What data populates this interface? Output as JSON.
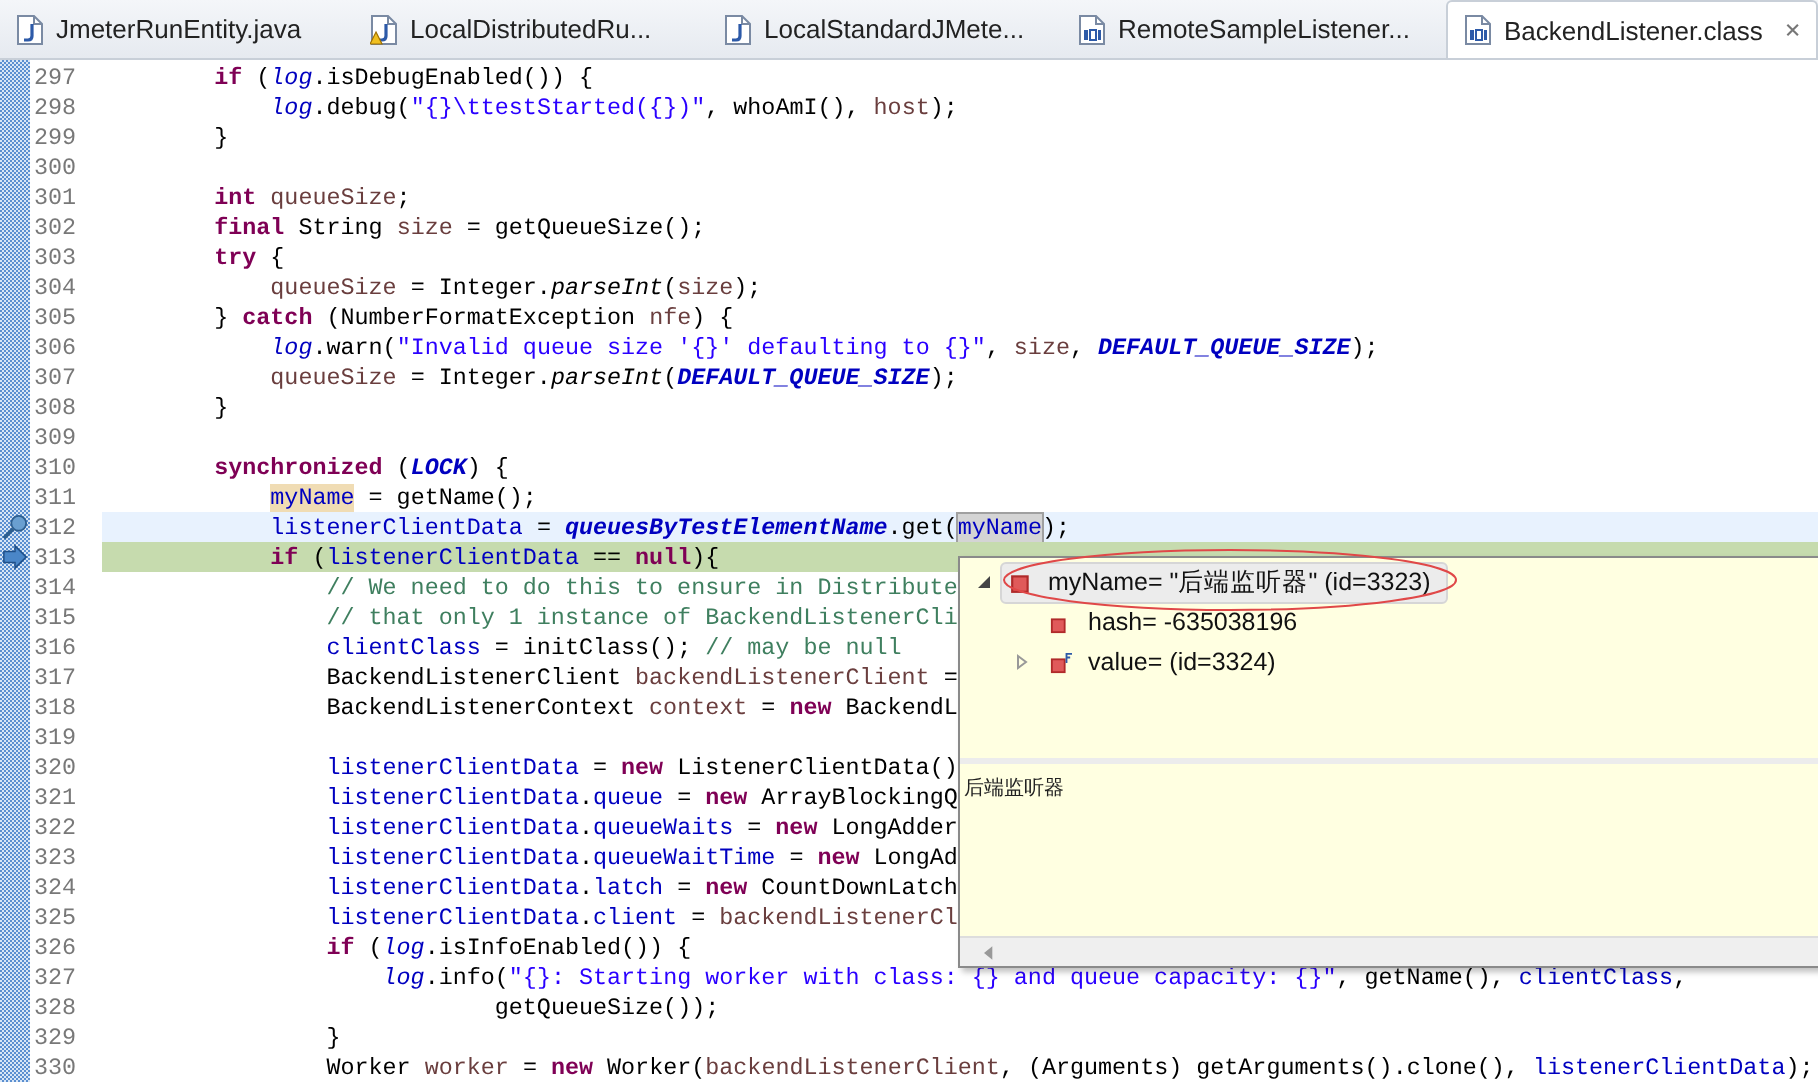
{
  "tabs": [
    {
      "label": "JmeterRunEntity.java",
      "kind": "java",
      "selected": false
    },
    {
      "label": "LocalDistributedRu...",
      "kind": "warning",
      "selected": false
    },
    {
      "label": "LocalStandardJMete...",
      "kind": "java",
      "selected": false
    },
    {
      "label": "RemoteSampleListener...",
      "kind": "class",
      "selected": false
    },
    {
      "label": "BackendListener.class",
      "kind": "class",
      "selected": true
    }
  ],
  "lines": [
    {
      "number": "297",
      "kind": "normal",
      "segments": [
        {
          "t": "        if",
          "kind": "kw"
        },
        {
          "t": " (",
          "kind": "plain"
        },
        {
          "t": "log",
          "kind": "sf"
        },
        {
          "t": ".isDebugEnabled()) {",
          "kind": "plain"
        }
      ]
    },
    {
      "number": "298",
      "kind": "normal",
      "segments": [
        {
          "t": "            log",
          "kind": "sf"
        },
        {
          "t": ".debug(",
          "kind": "plain"
        },
        {
          "t": "\"{}\\ttestStarted({})\"",
          "kind": "str"
        },
        {
          "t": ", whoAmI(), ",
          "kind": "plain"
        },
        {
          "t": "host",
          "kind": "local"
        },
        {
          "t": ");",
          "kind": "plain"
        }
      ]
    },
    {
      "number": "299",
      "kind": "normal",
      "segments": [
        {
          "t": "        }",
          "kind": "plain"
        }
      ]
    },
    {
      "number": "300",
      "kind": "normal"
    },
    {
      "number": "301",
      "kind": "normal",
      "segments": [
        {
          "t": "        int",
          "kind": "kw"
        },
        {
          "t": " queueSize",
          "kind": "local"
        },
        {
          "t": ";",
          "kind": "plain"
        }
      ]
    },
    {
      "number": "302",
      "kind": "normal",
      "segments": [
        {
          "t": "        final",
          "kind": "kw"
        },
        {
          "t": " String ",
          "kind": "plain"
        },
        {
          "t": "size",
          "kind": "local"
        },
        {
          "t": " = getQueueSize();",
          "kind": "plain"
        }
      ]
    },
    {
      "number": "303",
      "kind": "normal",
      "segments": [
        {
          "t": "        try",
          "kind": "kw"
        },
        {
          "t": " {",
          "kind": "plain"
        }
      ]
    },
    {
      "number": "304",
      "kind": "normal",
      "segments": [
        {
          "t": "            queueSize",
          "kind": "local"
        },
        {
          "t": " = Integer.",
          "kind": "plain"
        },
        {
          "t": "parseInt",
          "kind": "italic"
        },
        {
          "t": "(",
          "kind": "plain"
        },
        {
          "t": "size",
          "kind": "local"
        },
        {
          "t": ");",
          "kind": "plain"
        }
      ]
    },
    {
      "number": "305",
      "kind": "normal",
      "segments": [
        {
          "t": "        } ",
          "kind": "plain"
        },
        {
          "t": "catch",
          "kind": "kw"
        },
        {
          "t": " (NumberFormatException ",
          "kind": "plain"
        },
        {
          "t": "nfe",
          "kind": "local"
        },
        {
          "t": ") {",
          "kind": "plain"
        }
      ]
    },
    {
      "number": "306",
      "kind": "normal",
      "segments": [
        {
          "t": "            log",
          "kind": "sf"
        },
        {
          "t": ".warn(",
          "kind": "plain"
        },
        {
          "t": "\"Invalid queue size '{}' defaulting to {}\"",
          "kind": "str"
        },
        {
          "t": ", ",
          "kind": "plain"
        },
        {
          "t": "size",
          "kind": "local"
        },
        {
          "t": ", ",
          "kind": "plain"
        },
        {
          "t": "DEFAULT_QUEUE_SIZE",
          "kind": "const"
        },
        {
          "t": ");",
          "kind": "plain"
        }
      ]
    },
    {
      "number": "307",
      "kind": "normal",
      "segments": [
        {
          "t": "            queueSize",
          "kind": "local"
        },
        {
          "t": " = Integer.",
          "kind": "plain"
        },
        {
          "t": "parseInt",
          "kind": "italic"
        },
        {
          "t": "(",
          "kind": "plain"
        },
        {
          "t": "DEFAULT_QUEUE_SIZE",
          "kind": "const"
        },
        {
          "t": ");",
          "kind": "plain"
        }
      ]
    },
    {
      "number": "308",
      "kind": "normal",
      "segments": [
        {
          "t": "        }",
          "kind": "plain"
        }
      ]
    },
    {
      "number": "309",
      "kind": "normal"
    },
    {
      "number": "310",
      "kind": "normal",
      "segments": [
        {
          "t": "        synchronized",
          "kind": "kw"
        },
        {
          "t": " (",
          "kind": "plain"
        },
        {
          "t": "LOCK",
          "kind": "const"
        },
        {
          "t": ") {",
          "kind": "plain"
        }
      ]
    },
    {
      "number": "311",
      "kind": "normal",
      "segments": [
        {
          "t": "            myName",
          "kind": "field",
          "occurrence": true
        },
        {
          "t": " = getName();",
          "kind": "plain"
        }
      ]
    },
    {
      "number": "312",
      "kind": "cursor",
      "segments": [
        {
          "t": "            listenerClientData",
          "kind": "field"
        },
        {
          "t": " = ",
          "kind": "plain"
        },
        {
          "t": "queuesByTestElementName",
          "kind": "const"
        },
        {
          "t": ".get(",
          "kind": "plain"
        },
        {
          "t": "myName",
          "kind": "field",
          "hovered": true
        },
        {
          "t": ");",
          "kind": "plain"
        }
      ]
    },
    {
      "number": "313",
      "kind": "execution",
      "segments": [
        {
          "t": "            if",
          "kind": "kw"
        },
        {
          "t": " (",
          "kind": "plain"
        },
        {
          "t": "listenerClientData",
          "kind": "field"
        },
        {
          "t": " == ",
          "kind": "plain"
        },
        {
          "t": "null",
          "kind": "kw"
        },
        {
          "t": "){",
          "kind": "plain"
        }
      ]
    },
    {
      "number": "314",
      "kind": "normal",
      "segments": [
        {
          "t": "                // We need to do this to ensure in Distribute",
          "kind": "comment"
        }
      ]
    },
    {
      "number": "315",
      "kind": "normal",
      "segments": [
        {
          "t": "                // that only 1 instance of BackendListenerCli",
          "kind": "comment"
        }
      ]
    },
    {
      "number": "316",
      "kind": "normal",
      "segments": [
        {
          "t": "                clientClass",
          "kind": "field"
        },
        {
          "t": " = initClass(); ",
          "kind": "plain"
        },
        {
          "t": "// may be null",
          "kind": "comment"
        }
      ]
    },
    {
      "number": "317",
      "kind": "normal",
      "segments": [
        {
          "t": "                BackendListenerClient ",
          "kind": "plain"
        },
        {
          "t": "backendListenerClient",
          "kind": "local"
        },
        {
          "t": " =",
          "kind": "plain"
        }
      ]
    },
    {
      "number": "318",
      "kind": "normal",
      "segments": [
        {
          "t": "                BackendListenerContext ",
          "kind": "plain"
        },
        {
          "t": "context",
          "kind": "local"
        },
        {
          "t": " = ",
          "kind": "plain"
        },
        {
          "t": "new",
          "kind": "kw"
        },
        {
          "t": " BackendL",
          "kind": "plain"
        }
      ]
    },
    {
      "number": "319",
      "kind": "normal"
    },
    {
      "number": "320",
      "kind": "normal",
      "segments": [
        {
          "t": "                listenerClientData",
          "kind": "field"
        },
        {
          "t": " = ",
          "kind": "plain"
        },
        {
          "t": "new",
          "kind": "kw"
        },
        {
          "t": " ListenerClientData()",
          "kind": "plain"
        }
      ]
    },
    {
      "number": "321",
      "kind": "normal",
      "segments": [
        {
          "t": "                listenerClientData",
          "kind": "field"
        },
        {
          "t": ".",
          "kind": "plain"
        },
        {
          "t": "queue",
          "kind": "field"
        },
        {
          "t": " = ",
          "kind": "plain"
        },
        {
          "t": "new",
          "kind": "kw"
        },
        {
          "t": " ArrayBlockingQ",
          "kind": "plain"
        }
      ]
    },
    {
      "number": "322",
      "kind": "normal",
      "segments": [
        {
          "t": "                listenerClientData",
          "kind": "field"
        },
        {
          "t": ".",
          "kind": "plain"
        },
        {
          "t": "queueWaits",
          "kind": "field"
        },
        {
          "t": " = ",
          "kind": "plain"
        },
        {
          "t": "new",
          "kind": "kw"
        },
        {
          "t": " LongAdder",
          "kind": "plain"
        }
      ]
    },
    {
      "number": "323",
      "kind": "normal",
      "segments": [
        {
          "t": "                listenerClientData",
          "kind": "field"
        },
        {
          "t": ".",
          "kind": "plain"
        },
        {
          "t": "queueWaitTime",
          "kind": "field"
        },
        {
          "t": " = ",
          "kind": "plain"
        },
        {
          "t": "new",
          "kind": "kw"
        },
        {
          "t": " LongAd",
          "kind": "plain"
        }
      ]
    },
    {
      "number": "324",
      "kind": "normal",
      "segments": [
        {
          "t": "                listenerClientData",
          "kind": "field"
        },
        {
          "t": ".",
          "kind": "plain"
        },
        {
          "t": "latch",
          "kind": "field"
        },
        {
          "t": " = ",
          "kind": "plain"
        },
        {
          "t": "new",
          "kind": "kw"
        },
        {
          "t": " CountDownLatch",
          "kind": "plain"
        }
      ]
    },
    {
      "number": "325",
      "kind": "normal",
      "segments": [
        {
          "t": "                listenerClientData",
          "kind": "field"
        },
        {
          "t": ".",
          "kind": "plain"
        },
        {
          "t": "client",
          "kind": "field"
        },
        {
          "t": " = ",
          "kind": "plain"
        },
        {
          "t": "backendListenerCl",
          "kind": "local"
        }
      ]
    },
    {
      "number": "326",
      "kind": "normal",
      "segments": [
        {
          "t": "                if",
          "kind": "kw"
        },
        {
          "t": " (",
          "kind": "plain"
        },
        {
          "t": "log",
          "kind": "sf"
        },
        {
          "t": ".isInfoEnabled()) {",
          "kind": "plain"
        }
      ]
    },
    {
      "number": "327",
      "kind": "normal",
      "segments": [
        {
          "t": "                    log",
          "kind": "sf"
        },
        {
          "t": ".info(",
          "kind": "plain"
        },
        {
          "t": "\"{}: Starting worker with class: {} and queue capacity: {}\"",
          "kind": "str"
        },
        {
          "t": ", getName(), ",
          "kind": "plain"
        },
        {
          "t": "clientClass",
          "kind": "field"
        },
        {
          "t": ",",
          "kind": "plain"
        }
      ]
    },
    {
      "number": "328",
      "kind": "normal",
      "segments": [
        {
          "t": "                            getQueueSize());",
          "kind": "plain"
        }
      ]
    },
    {
      "number": "329",
      "kind": "normal",
      "segments": [
        {
          "t": "                }",
          "kind": "plain"
        }
      ]
    },
    {
      "number": "330",
      "kind": "normal",
      "segments": [
        {
          "t": "                Worker ",
          "kind": "plain"
        },
        {
          "t": "worker",
          "kind": "local"
        },
        {
          "t": " = ",
          "kind": "plain"
        },
        {
          "t": "new",
          "kind": "kw"
        },
        {
          "t": " Worker(",
          "kind": "plain"
        },
        {
          "t": "backendListenerClient",
          "kind": "local"
        },
        {
          "t": ", (Arguments) getArguments().clone(), ",
          "kind": "plain"
        },
        {
          "t": "listenerClientData",
          "kind": "field"
        },
        {
          "t": ");",
          "kind": "plain"
        }
      ]
    }
  ],
  "inspect_popup": {
    "tree": [
      {
        "label": "myName= \"后端监听器\" (id=3323)",
        "selected": true,
        "expanded": true,
        "children": [
          {
            "label": "hash= -635038196",
            "final": false
          },
          {
            "label": "value= (id=3324)",
            "final": true,
            "expanded": false
          }
        ]
      }
    ],
    "detail": "后端监听器"
  }
}
